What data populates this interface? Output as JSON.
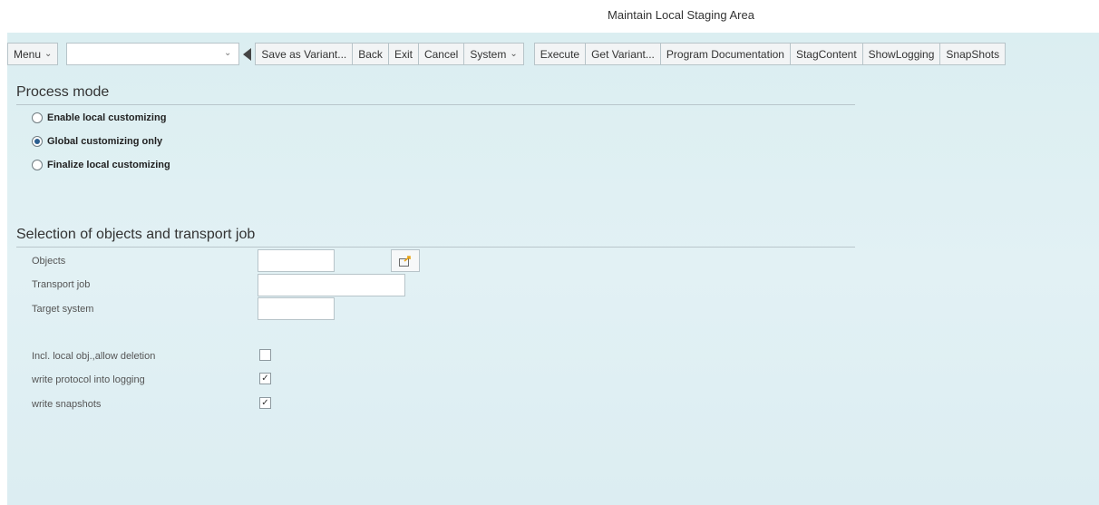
{
  "window": {
    "title": "Maintain Local Staging Area"
  },
  "toolbar": {
    "menu_label": "Menu",
    "command_value": "",
    "buttons": [
      "Save as Variant...",
      "Back",
      "Exit",
      "Cancel",
      "System",
      "Execute",
      "Get Variant...",
      "Program Documentation",
      "StagContent",
      "ShowLogging",
      "SnapShots"
    ]
  },
  "process_mode": {
    "title": "Process mode",
    "options": [
      {
        "label": "Enable local customizing",
        "selected": false
      },
      {
        "label": "Global customizing only",
        "selected": true
      },
      {
        "label": "Finalize local customizing",
        "selected": false
      }
    ]
  },
  "selection": {
    "title": "Selection of objects and transport job",
    "fields": [
      {
        "label": "Objects",
        "value": ""
      },
      {
        "label": "Transport job",
        "value": ""
      },
      {
        "label": "Target system",
        "value": ""
      }
    ],
    "checkboxes": [
      {
        "label": "Incl. local obj.,allow deletion",
        "checked": false
      },
      {
        "label": "write protocol into logging",
        "checked": true
      },
      {
        "label": "write snapshots",
        "checked": true
      }
    ]
  },
  "colors": {
    "background": "#dbeef1",
    "radio_dot": "#2a5e8f",
    "value_help_icon": "#e8a317"
  },
  "icons": {
    "value_help": "multiple-selection-icon",
    "back_arrow": "triangle-left-icon"
  }
}
